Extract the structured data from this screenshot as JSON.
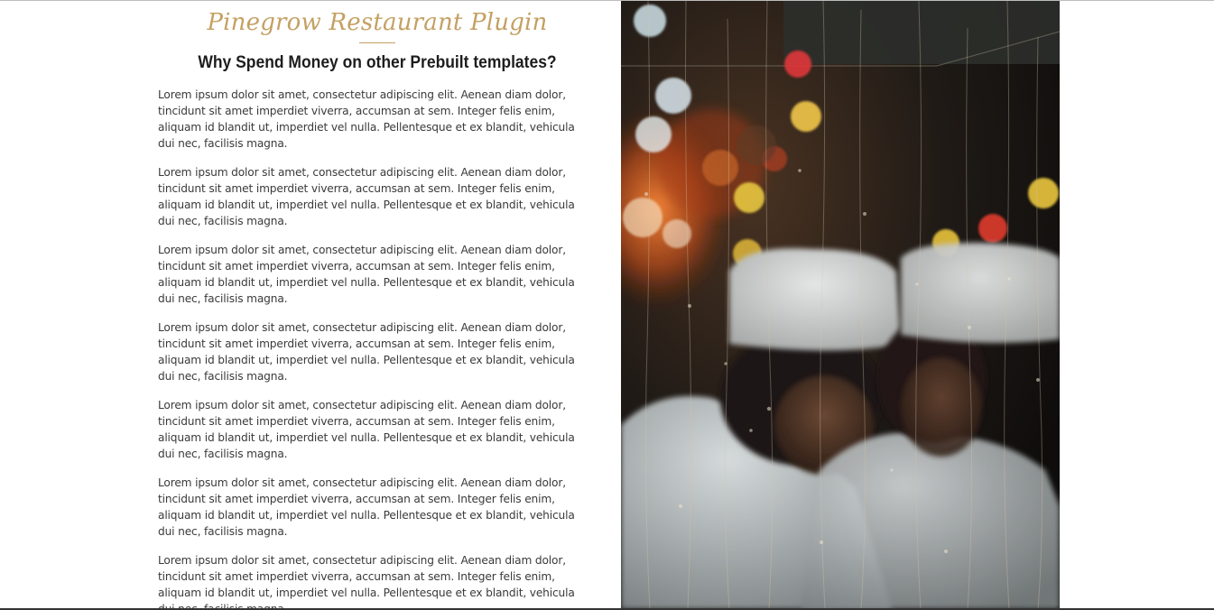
{
  "section": {
    "script_title": "Pinegrow Restaurant Plugin",
    "headline": "Why Spend Money on other Prebuilt templates?",
    "paragraphs": [
      "Lorem ipsum dolor sit amet, consectetur adipiscing elit. Aenean diam dolor, tincidunt sit amet imperdiet viverra, accumsan at sem. Integer felis enim, aliquam id blandit ut, imperdiet vel nulla. Pellentesque et ex blandit, vehicula dui nec, facilisis magna.",
      "Lorem ipsum dolor sit amet, consectetur adipiscing elit. Aenean diam dolor, tincidunt sit amet imperdiet viverra, accumsan at sem. Integer felis enim, aliquam id blandit ut, imperdiet vel nulla. Pellentesque et ex blandit, vehicula dui nec, facilisis magna.",
      "Lorem ipsum dolor sit amet, consectetur adipiscing elit. Aenean diam dolor, tincidunt sit amet imperdiet viverra, accumsan at sem. Integer felis enim, aliquam id blandit ut, imperdiet vel nulla. Pellentesque et ex blandit, vehicula dui nec, facilisis magna.",
      "Lorem ipsum dolor sit amet, consectetur adipiscing elit. Aenean diam dolor, tincidunt sit amet imperdiet viverra, accumsan at sem. Integer felis enim, aliquam id blandit ut, imperdiet vel nulla. Pellentesque et ex blandit, vehicula dui nec, facilisis magna.",
      "Lorem ipsum dolor sit amet, consectetur adipiscing elit. Aenean diam dolor, tincidunt sit amet imperdiet viverra, accumsan at sem. Integer felis enim, aliquam id blandit ut, imperdiet vel nulla. Pellentesque et ex blandit, vehicula dui nec, facilisis magna.",
      "Lorem ipsum dolor sit amet, consectetur adipiscing elit. Aenean diam dolor, tincidunt sit amet imperdiet viverra, accumsan at sem. Integer felis enim, aliquam id blandit ut, imperdiet vel nulla. Pellentesque et ex blandit, vehicula dui nec, facilisis magna.",
      "Lorem ipsum dolor sit amet, consectetur adipiscing elit. Aenean diam dolor, tincidunt sit amet imperdiet viverra, accumsan at sem. Integer felis enim, aliquam id blandit ut, imperdiet vel nulla. Pellentesque et ex blandit, vehicula dui nec, facilisis magna."
    ]
  },
  "photo": {
    "subject": "chefs-behind-rainy-window-photo"
  },
  "colors": {
    "accent_gold": "#c4a063",
    "heading_dark": "#1d1d1d",
    "body_text": "#3a3a3a"
  }
}
